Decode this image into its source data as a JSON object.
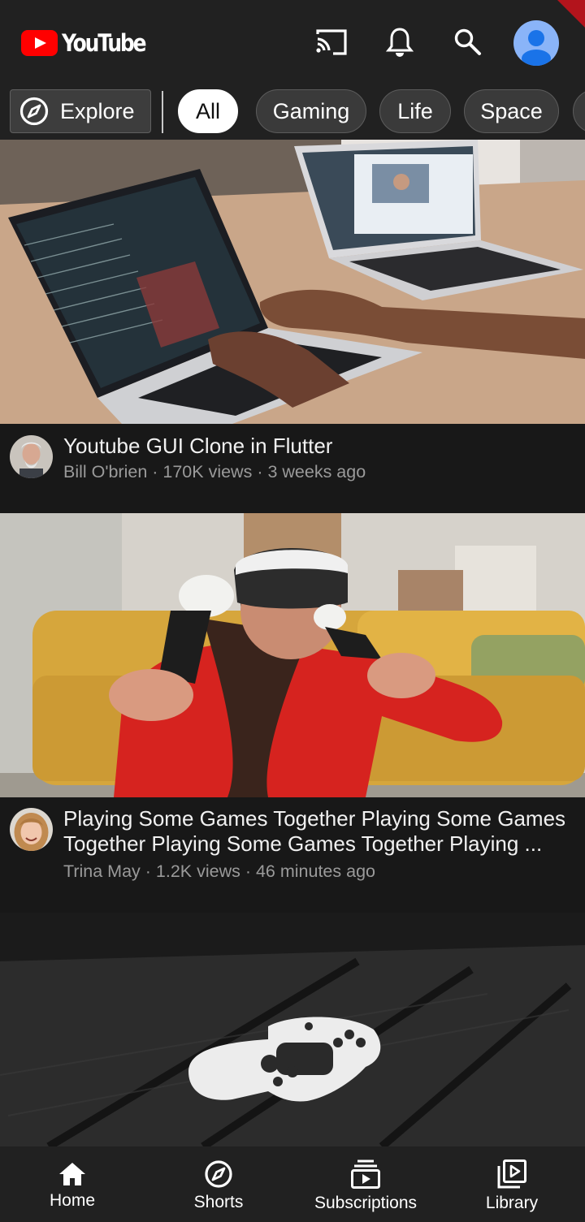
{
  "app": {
    "logo_text": "YouTube"
  },
  "header": {
    "icons": [
      "cast-icon",
      "bell-icon",
      "search-icon",
      "account-avatar"
    ]
  },
  "chips": {
    "explore_label": "Explore",
    "items": [
      {
        "label": "All",
        "active": true
      },
      {
        "label": "Gaming",
        "active": false
      },
      {
        "label": "Life",
        "active": false
      },
      {
        "label": "Space",
        "active": false
      }
    ]
  },
  "videos": [
    {
      "title": "Youtube GUI Clone in Flutter",
      "channel": "Bill O'brien",
      "views": "170K views",
      "age": "3 weeks ago"
    },
    {
      "title": "Playing Some Games Together Playing Some Games Together Playing Some Games Together Playing ...",
      "channel": "Trina May",
      "views": "1.2K views",
      "age": "46 minutes ago"
    }
  ],
  "meta_separator": " · ",
  "bottom_nav": [
    {
      "label": "Home",
      "icon": "home-icon"
    },
    {
      "label": "Shorts",
      "icon": "compass-icon"
    },
    {
      "label": "Subscriptions",
      "icon": "subscriptions-icon"
    },
    {
      "label": "Library",
      "icon": "library-icon"
    }
  ],
  "colors": {
    "background": "#181818",
    "bars": "#212121",
    "brand_red": "#ff0000",
    "avatar_blue": "#8ab4f8"
  }
}
